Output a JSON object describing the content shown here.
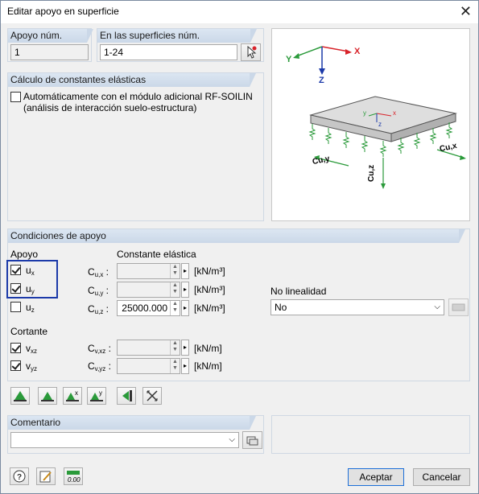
{
  "window": {
    "title": "Editar apoyo en superficie"
  },
  "apoyo": {
    "label": "Apoyo núm.",
    "value": "1"
  },
  "superficies": {
    "label": "En las superficies núm.",
    "value": "1-24"
  },
  "calculo": {
    "header": "Cálculo de constantes elásticas",
    "checkbox_line1": "Automáticamente con el módulo adicional RF-SOILIN",
    "checkbox_line2": "(análisis de interacción suelo-estructura)"
  },
  "diagram": {
    "x": "X",
    "y": "Y",
    "z": "Z",
    "cux": "Cu,x",
    "cuy": "Cu,y",
    "cuz": "Cu,z",
    "sx": "x",
    "sy": "y",
    "sz": "z"
  },
  "condiciones": {
    "header": "Condiciones de apoyo",
    "apoyo_label": "Apoyo",
    "constante_label": "Constante elástica",
    "ux": "u",
    "ux_sub": "x",
    "uy": "u",
    "uy_sub": "y",
    "uz": "u",
    "uz_sub": "z",
    "cux": "C",
    "cux_sub": "u,x",
    "cux_unit": "[kN/m³]",
    "cuy": "C",
    "cuy_sub": "u,y",
    "cuy_unit": "[kN/m³]",
    "cuz": "C",
    "cuz_sub": "u,z",
    "cuz_unit": "[kN/m³]",
    "cuz_value": "25000.000",
    "cortante_label": "Cortante",
    "vxz": "v",
    "vxz_sub": "xz",
    "vyz": "v",
    "vyz_sub": "yz",
    "cvxz": "C",
    "cvxz_sub": "v,xz",
    "cvxz_unit": "[kN/m]",
    "cvyz": "C",
    "cvyz_sub": "v,yz",
    "cvyz_unit": "[kN/m]",
    "nolinealidad_label": "No linealidad",
    "nolinealidad_value": "No"
  },
  "comentario": {
    "label": "Comentario",
    "value": ""
  },
  "buttons": {
    "accept": "Aceptar",
    "cancel": "Cancelar"
  },
  "colors": {
    "accent": "#1c3aa9",
    "green": "#2a9a3a",
    "red": "#d8232a"
  }
}
